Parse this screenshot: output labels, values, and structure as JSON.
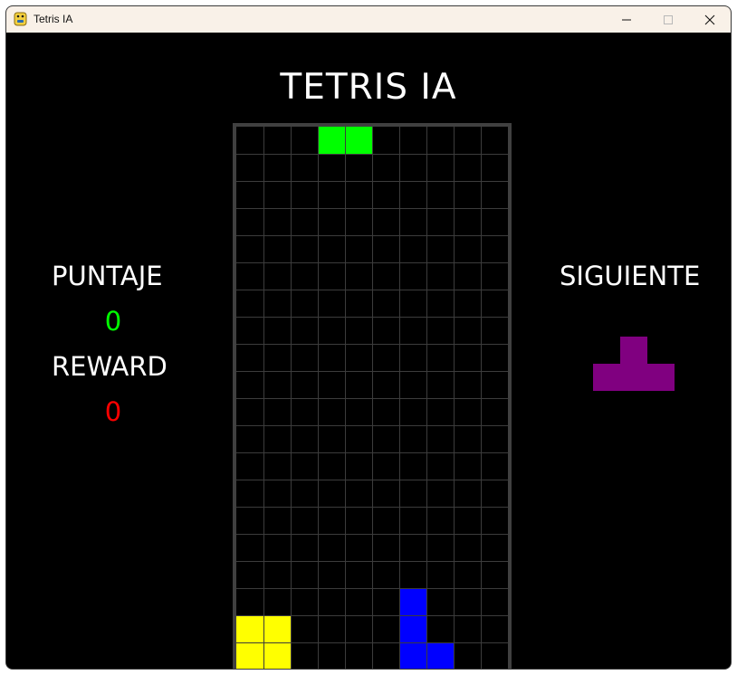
{
  "window": {
    "title": "Tetris IA",
    "app_icon": "python-icon",
    "controls": [
      "minimize-icon",
      "maximize-icon",
      "close-icon"
    ]
  },
  "game": {
    "title": "TETRIS IA",
    "score_label": "PUNTAJE",
    "score_value": "0",
    "reward_label": "REWARD",
    "reward_value": "0",
    "next_label": "SIGUIENTE"
  },
  "colors": {
    "background": "#000000",
    "grid_line": "#3c3c3c",
    "board_border": "#404040",
    "score": "#00ff00",
    "reward": "#ff0000",
    "piece_green": "#00ff00",
    "piece_yellow": "#ffff00",
    "piece_blue": "#0000ff",
    "piece_purple": "#800080"
  },
  "board": {
    "columns": 10,
    "rows": 20,
    "cells": [
      {
        "col": 3,
        "row": 0,
        "color": "#00ff00"
      },
      {
        "col": 4,
        "row": 0,
        "color": "#00ff00"
      },
      {
        "col": 6,
        "row": 17,
        "color": "#0000ff"
      },
      {
        "col": 6,
        "row": 18,
        "color": "#0000ff"
      },
      {
        "col": 6,
        "row": 19,
        "color": "#0000ff"
      },
      {
        "col": 7,
        "row": 19,
        "color": "#0000ff"
      },
      {
        "col": 0,
        "row": 18,
        "color": "#ffff00"
      },
      {
        "col": 1,
        "row": 18,
        "color": "#ffff00"
      },
      {
        "col": 0,
        "row": 19,
        "color": "#ffff00"
      },
      {
        "col": 1,
        "row": 19,
        "color": "#ffff00"
      }
    ]
  },
  "next_piece": {
    "type": "T",
    "color": "#800080",
    "cells": [
      {
        "col": 1,
        "row": 0
      },
      {
        "col": 0,
        "row": 1
      },
      {
        "col": 1,
        "row": 1
      },
      {
        "col": 2,
        "row": 1
      }
    ]
  }
}
